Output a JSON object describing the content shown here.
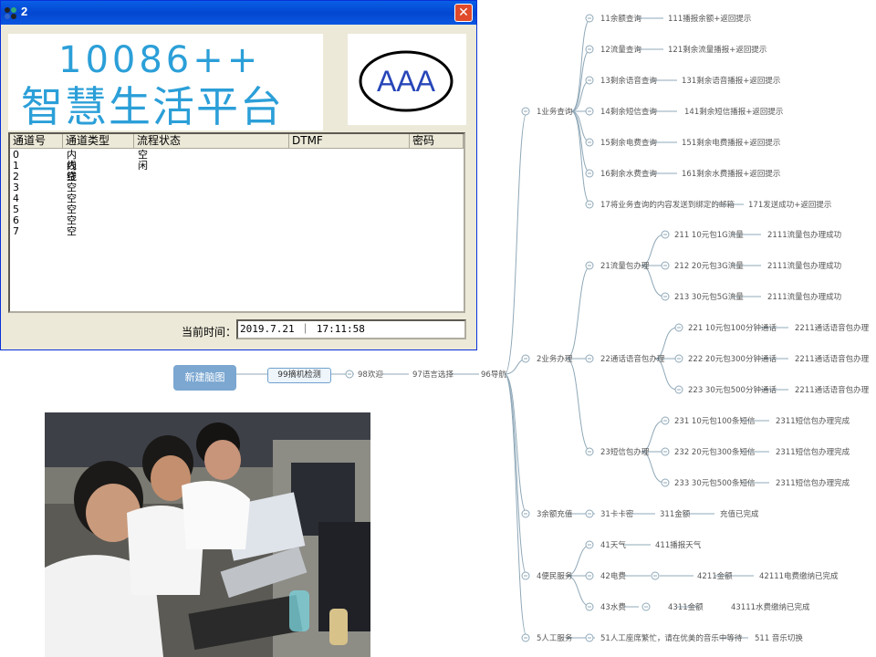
{
  "window": {
    "title": "2",
    "close_glyph": "✕",
    "banner_line1": "10086++",
    "banner_line2": "智慧生活平台",
    "logo_text": "AAA"
  },
  "channel_table": {
    "columns": [
      "通道号",
      "通道类型",
      "流程状态",
      "DTMF",
      "密码"
    ],
    "rows": [
      {
        "num": "0",
        "type": "内线",
        "state": "空闲"
      },
      {
        "num": "1",
        "type": "内线",
        "state": ""
      },
      {
        "num": "2",
        "type": "空",
        "state": ""
      },
      {
        "num": "3",
        "type": "空",
        "state": ""
      },
      {
        "num": "4",
        "type": "空",
        "state": ""
      },
      {
        "num": "5",
        "type": "空",
        "state": ""
      },
      {
        "num": "6",
        "type": "空",
        "state": ""
      },
      {
        "num": "7",
        "type": "空",
        "state": ""
      }
    ]
  },
  "time": {
    "label": "当前时间：",
    "value": "2019.7.21 ｜ 17:11:58"
  },
  "mindmap": {
    "new_button": "新建脑图",
    "chain": [
      "99摘机检测",
      "98欢迎",
      "97语言选择",
      "96导航"
    ],
    "branches": [
      {
        "label": "1业务查询",
        "children": [
          {
            "label": "11余额查询",
            "result": "111播报余额+返回提示"
          },
          {
            "label": "12流量查询",
            "result": "121剩余流量播报+返回提示"
          },
          {
            "label": "13剩余语音查询",
            "result": "131剩余语音播报+返回提示"
          },
          {
            "label": "14剩余短信查询",
            "result": "141剩余短信播报+返回提示"
          },
          {
            "label": "15剩余电费查询",
            "result": "151剩余电费播报+返回提示"
          },
          {
            "label": "16剩余水费查询",
            "result": "161剩余水费播报+返回提示"
          },
          {
            "label": "17将业务查询的内容发送到绑定的邮箱",
            "result": "171发送成功+返回提示"
          }
        ]
      },
      {
        "label": "2业务办理",
        "groups": [
          {
            "label": "21流量包办理",
            "items": [
              {
                "label": "211 10元包1G流量",
                "result": "2111流量包办理成功"
              },
              {
                "label": "212 20元包3G流量",
                "result": "2111流量包办理成功"
              },
              {
                "label": "213 30元包5G流量",
                "result": "2111流量包办理成功"
              }
            ]
          },
          {
            "label": "22通话语音包办理",
            "items": [
              {
                "label": "221 10元包100分钟通话",
                "result": "2211通话语音包办理"
              },
              {
                "label": "222 20元包300分钟通话",
                "result": "2211通话语音包办理"
              },
              {
                "label": "223 30元包500分钟通话",
                "result": "2211通话语音包办理"
              }
            ]
          },
          {
            "label": "23短信包办理",
            "items": [
              {
                "label": "231 10元包100条短信",
                "result": "2311短信包办理完成"
              },
              {
                "label": "232 20元包300条短信",
                "result": "2311短信包办理完成"
              },
              {
                "label": "233 30元包500条短信",
                "result": "2311短信包办理完成"
              }
            ]
          }
        ]
      },
      {
        "label": "3余额充值",
        "path": [
          "31卡卡密",
          "311金额",
          "充值已完成"
        ]
      },
      {
        "label": "4便民服务",
        "children": [
          {
            "label": "41天气",
            "result": "411播报天气"
          },
          {
            "label": "42电费",
            "sub": "4211金额",
            "result": "42111电费缴纳已完成"
          },
          {
            "label": "43水费",
            "sub": "4311金额",
            "result": "43111水费缴纳已完成"
          }
        ]
      },
      {
        "label": "5人工服务",
        "path": [
          "51人工座席繁忙，请在优美的音乐中等待",
          "511 音乐切换"
        ]
      }
    ]
  },
  "colors": {
    "line": "#8fa8b8",
    "accent": "#7ba7d1",
    "title_blue": "#0a56e0"
  }
}
